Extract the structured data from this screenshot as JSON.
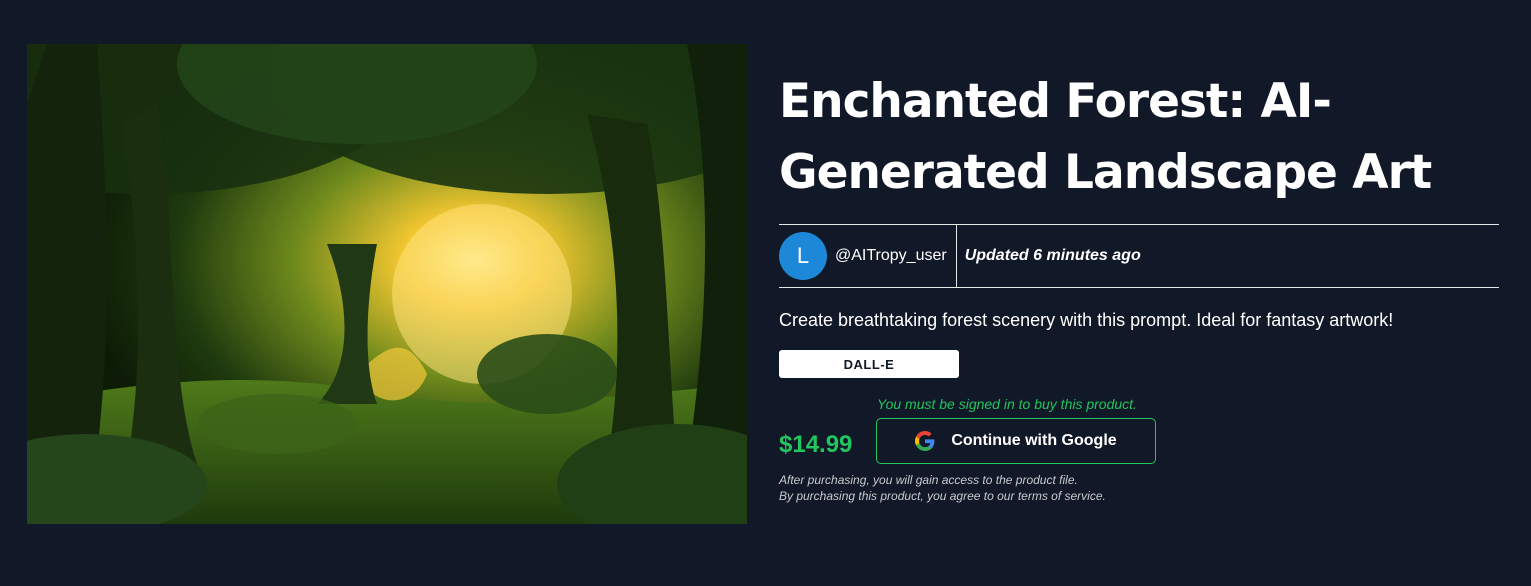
{
  "product": {
    "title": "Enchanted Forest: AI-Generated Landscape Art",
    "image_icon": "forest-landscape-image",
    "description": "Create breathtaking forest scenery with this prompt. Ideal for fantasy artwork!",
    "model": "DALL-E",
    "price": "$14.99"
  },
  "author": {
    "avatar_letter": "L",
    "username": "@AITropy_user",
    "updated": "Updated 6 minutes ago"
  },
  "purchase": {
    "signin_note": "You must be signed in to buy this product.",
    "google_button_label": "Continue with Google",
    "google_icon": "google-g-icon",
    "legal_line_1": "After purchasing, you will gain access to the product file.",
    "legal_line_2_prefix": "By purchasing this product, you agree to our ",
    "legal_terms_link": "terms of service",
    "legal_line_2_suffix": "."
  },
  "colors": {
    "background": "#111827",
    "accent_green": "#22c55e",
    "avatar_blue": "#1e88d8",
    "text_white": "#ffffff"
  }
}
